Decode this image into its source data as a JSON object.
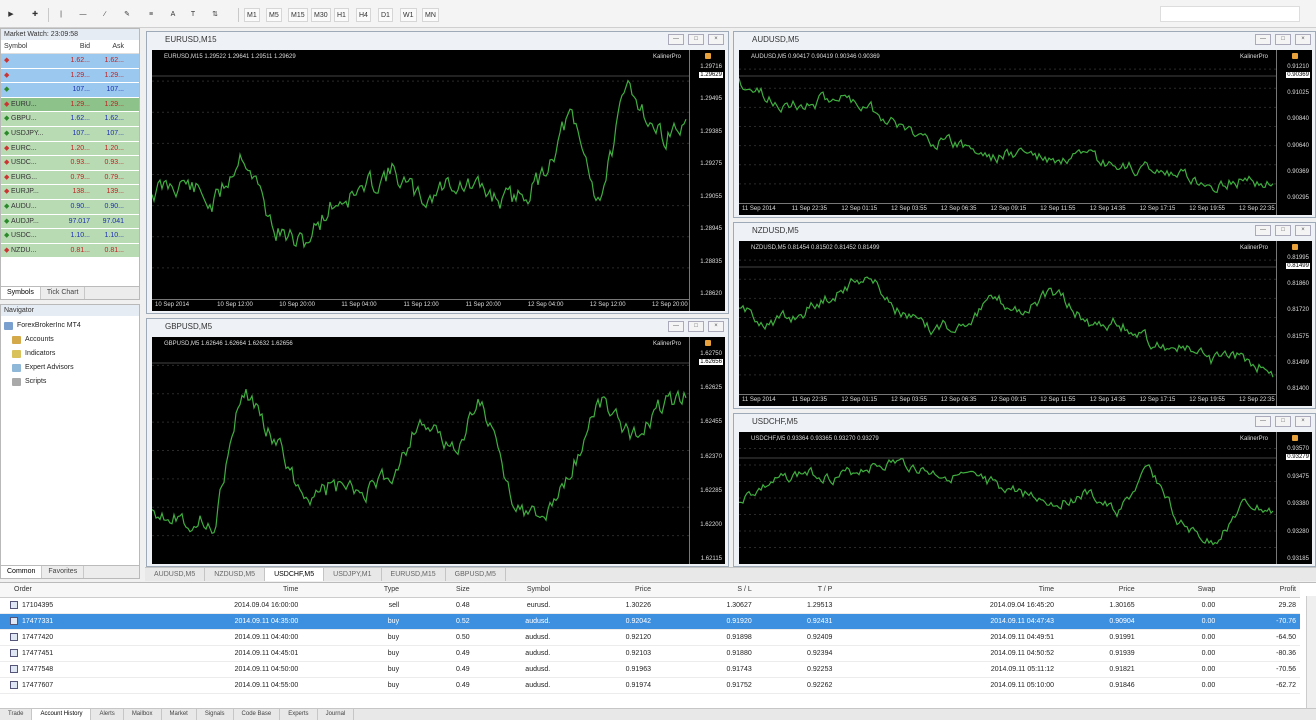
{
  "toolbar": {
    "timeframes": [
      "M1",
      "M5",
      "M15",
      "M30",
      "H1",
      "H4",
      "D1",
      "W1",
      "MN"
    ]
  },
  "market_watch": {
    "title": "Market Watch: 23:09:58",
    "headers": {
      "symbol": "Symbol",
      "bid": "Bid",
      "ask": "Ask"
    },
    "rows": [
      {
        "symbol": "",
        "bid": "1.62...",
        "ask": "1.62...",
        "color": "#9bc8ee",
        "dir": "down"
      },
      {
        "symbol": "",
        "bid": "1.29...",
        "ask": "1.29...",
        "color": "#9bc8ee",
        "dir": "down"
      },
      {
        "symbol": "",
        "bid": "107...",
        "ask": "107...",
        "color": "#9bc8ee",
        "dir": "up"
      },
      {
        "symbol": "EURU...",
        "bid": "1.29...",
        "ask": "1.29...",
        "color": "#8dc28b",
        "dir": "down"
      },
      {
        "symbol": "GBPU...",
        "bid": "1.62...",
        "ask": "1.62...",
        "color": "#b9dbb4",
        "dir": "up"
      },
      {
        "symbol": "USDJPY...",
        "bid": "107...",
        "ask": "107...",
        "color": "#b9dbb4",
        "dir": "up"
      },
      {
        "symbol": "EURC...",
        "bid": "1.20...",
        "ask": "1.20...",
        "color": "#b9dbb4",
        "dir": "down"
      },
      {
        "symbol": "USDC...",
        "bid": "0.93...",
        "ask": "0.93...",
        "color": "#b9dbb4",
        "dir": "down"
      },
      {
        "symbol": "EURG...",
        "bid": "0.79...",
        "ask": "0.79...",
        "color": "#b9dbb4",
        "dir": "down"
      },
      {
        "symbol": "EURJP...",
        "bid": "138...",
        "ask": "139...",
        "color": "#b9dbb4",
        "dir": "down"
      },
      {
        "symbol": "AUDU...",
        "bid": "0.90...",
        "ask": "0.90...",
        "color": "#b9dbb4",
        "dir": "up"
      },
      {
        "symbol": "AUDJP...",
        "bid": "97.017",
        "ask": "97.041",
        "color": "#b9dbb4",
        "dir": "up"
      },
      {
        "symbol": "USDC...",
        "bid": "1.10...",
        "ask": "1.10...",
        "color": "#b9dbb4",
        "dir": "up"
      },
      {
        "symbol": "NZDU...",
        "bid": "0.81...",
        "ask": "0.81...",
        "color": "#b9dbb4",
        "dir": "down"
      }
    ],
    "tabs": [
      "Symbols",
      "Tick Chart"
    ]
  },
  "navigator": {
    "title": "Navigator",
    "root": "ForexBrokerInc MT4",
    "items": [
      "Accounts",
      "Indicators",
      "Expert Advisors",
      "Scripts"
    ],
    "tabs": [
      "Common",
      "Favorites"
    ]
  },
  "charts": [
    {
      "title": "EURUSD,M15",
      "info": "EURUSD,M15  1.29522 1.29641 1.29511 1.29629",
      "broker": "KalinerPro",
      "y_labels": [
        "1.29716",
        "1.29495",
        "1.29385",
        "1.29275",
        "1.29055",
        "1.28945",
        "1.28835",
        "1.28620"
      ],
      "x_labels": [
        "10 Sep 2014",
        "10 Sep 12:00",
        "10 Sep 20:00",
        "11 Sep 04:00",
        "11 Sep 12:00",
        "11 Sep 20:00",
        "12 Sep 04:00",
        "12 Sep 12:00",
        "12 Sep 20:00"
      ],
      "price": "1.29629",
      "seed": 11,
      "path": [
        0.55,
        0.5,
        0.62,
        0.35,
        0.72,
        0.8,
        0.6,
        0.55,
        0.45,
        0.6,
        0.5,
        0.55,
        0.6,
        0.5,
        0.2,
        0.6,
        0.05,
        0.3,
        0.25
      ]
    },
    {
      "title": "AUDUSD,M5",
      "info": "AUDUSD,M5  0.90417 0.90419 0.90346 0.90369",
      "broker": "KalinerPro",
      "y_labels": [
        "0.91210",
        "0.91025",
        "0.90840",
        "0.90640",
        "0.90369",
        "0.90295"
      ],
      "x_labels": [
        "11 Sep 2014",
        "11 Sep 22:35",
        "12 Sep 01:15",
        "12 Sep 03:55",
        "12 Sep 06:35",
        "12 Sep 09:15",
        "12 Sep 11:55",
        "12 Sep 14:35",
        "12 Sep 17:15",
        "12 Sep 19:55",
        "12 Sep 22:35"
      ],
      "price": "0.90369",
      "seed": 23,
      "path": [
        0.1,
        0.25,
        0.3,
        0.2,
        0.28,
        0.45,
        0.55,
        0.6,
        0.7,
        0.65,
        0.75,
        0.7,
        0.8,
        0.78,
        0.85,
        0.92,
        0.88,
        0.9
      ]
    },
    {
      "title": "GBPUSD,M5",
      "info": "GBPUSD,M5  1.62646 1.62664 1.62632 1.62656",
      "broker": "KalinerPro",
      "y_labels": [
        "1.62750",
        "1.62625",
        "1.62455",
        "1.62370",
        "1.62285",
        "1.62200",
        "1.62115"
      ],
      "x_labels": [],
      "price": "1.62656",
      "seed": 37,
      "path": [
        0.75,
        0.8,
        0.85,
        0.15,
        0.4,
        0.7,
        0.65,
        0.7,
        0.6,
        0.3,
        0.5,
        0.2,
        0.7,
        0.85,
        0.6,
        0.2,
        0.4,
        0.25,
        0.2
      ]
    },
    {
      "title": "NZDUSD,M5",
      "info": "NZDUSD,M5  0.81454 0.81502 0.81452 0.81499",
      "broker": "KalinerPro",
      "y_labels": [
        "0.81995",
        "0.81860",
        "0.81720",
        "0.81575",
        "0.81499",
        "0.81400"
      ],
      "x_labels": [
        "11 Sep 2014",
        "11 Sep 22:35",
        "12 Sep 01:15",
        "12 Sep 03:55",
        "12 Sep 06:35",
        "12 Sep 09:15",
        "12 Sep 11:55",
        "12 Sep 14:35",
        "12 Sep 17:15",
        "12 Sep 19:55",
        "12 Sep 22:35"
      ],
      "price": "0.81499",
      "seed": 51,
      "path": [
        0.4,
        0.5,
        0.4,
        0.25,
        0.1,
        0.4,
        0.55,
        0.5,
        0.3,
        0.4,
        0.25,
        0.5,
        0.5,
        0.65,
        0.7,
        0.8,
        0.78,
        0.9
      ]
    },
    {
      "title": "USDCHF,M5",
      "info": "USDCHF,M5  0.93364 0.93365 0.93270 0.93279",
      "broker": "KalinerPro",
      "y_labels": [
        "0.93570",
        "0.93475",
        "0.93380",
        "0.93280",
        "0.93185"
      ],
      "x_labels": [],
      "price": "0.93279",
      "seed": 67,
      "path": [
        0.45,
        0.3,
        0.2,
        0.25,
        0.15,
        0.1,
        0.2,
        0.25,
        0.3,
        0.4,
        0.5,
        0.4,
        0.6,
        0.15,
        0.7,
        0.9,
        0.5,
        0.6
      ]
    }
  ],
  "chart_tabs": [
    "AUDUSD,M5",
    "NZDUSD,M5",
    "USDCHF,M5",
    "USDJPY,M1",
    "EURUSD,M15",
    "GBPUSD,M5"
  ],
  "terminal": {
    "headers": [
      "Order",
      "Time",
      "Type",
      "Size",
      "Symbol",
      "Price",
      "S / L",
      "T / P",
      "Time",
      "Price",
      "Swap",
      "Profit"
    ],
    "rows": [
      {
        "cells": [
          "17104395",
          "2014.09.04 16:00:00",
          "sell",
          "0.48",
          "eurusd.",
          "1.30226",
          "1.30627",
          "1.29513",
          "2014.09.04 16:45:20",
          "1.30165",
          "0.00",
          "29.28"
        ],
        "selected": false
      },
      {
        "cells": [
          "17477331",
          "2014.09.11 04:35:00",
          "buy",
          "0.52",
          "audusd.",
          "0.92042",
          "0.91920",
          "0.92431",
          "2014.09.11 04:47:43",
          "0.90904",
          "0.00",
          "-70.76"
        ],
        "selected": true
      },
      {
        "cells": [
          "17477420",
          "2014.09.11 04:40:00",
          "buy",
          "0.50",
          "audusd.",
          "0.92120",
          "0.91898",
          "0.92409",
          "2014.09.11 04:49:51",
          "0.91991",
          "0.00",
          "-64.50"
        ],
        "selected": false
      },
      {
        "cells": [
          "17477451",
          "2014.09.11 04:45:01",
          "buy",
          "0.49",
          "audusd.",
          "0.92103",
          "0.91880",
          "0.92394",
          "2014.09.11 04:50:52",
          "0.91939",
          "0.00",
          "-80.36"
        ],
        "selected": false
      },
      {
        "cells": [
          "17477548",
          "2014.09.11 04:50:00",
          "buy",
          "0.49",
          "audusd.",
          "0.91963",
          "0.91743",
          "0.92253",
          "2014.09.11 05:11:12",
          "0.91821",
          "0.00",
          "-70.56"
        ],
        "selected": false
      },
      {
        "cells": [
          "17477607",
          "2014.09.11 04:55:00",
          "buy",
          "0.49",
          "audusd.",
          "0.91974",
          "0.91752",
          "0.92262",
          "2014.09.11 05:10:00",
          "0.91846",
          "0.00",
          "-62.72"
        ],
        "selected": false
      }
    ],
    "tabs": [
      "Trade",
      "Account History",
      "Alerts",
      "Mailbox",
      "Market",
      "Signals",
      "Code Base",
      "Experts",
      "Journal"
    ]
  }
}
